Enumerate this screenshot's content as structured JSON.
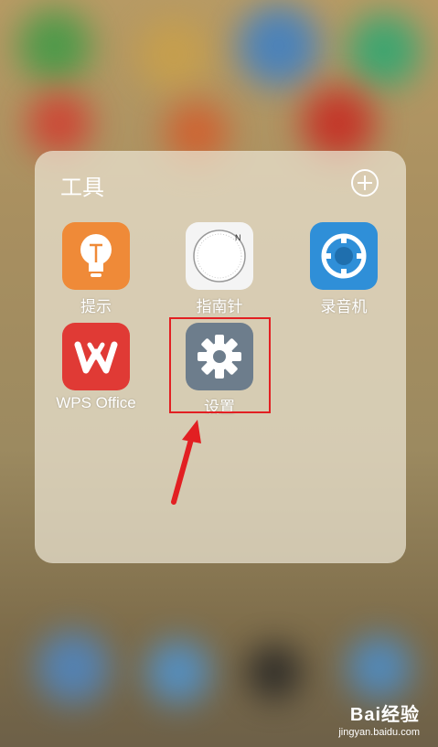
{
  "folder": {
    "title": "工具",
    "apps": [
      {
        "label": "提示",
        "icon": "lightbulb-icon"
      },
      {
        "label": "指南针",
        "icon": "compass-icon"
      },
      {
        "label": "录音机",
        "icon": "recorder-icon"
      },
      {
        "label": "WPS Office",
        "icon": "wps-icon"
      },
      {
        "label": "设置",
        "icon": "gear-icon"
      }
    ]
  },
  "watermark": {
    "brand": "Bai经验",
    "url": "jingyan.baidu.com"
  },
  "colors": {
    "highlight": "#e21f22",
    "tip": "#ef8a38",
    "recorder": "#2f8fd8",
    "wps": "#e03a35",
    "settings": "#6d7d8c"
  }
}
